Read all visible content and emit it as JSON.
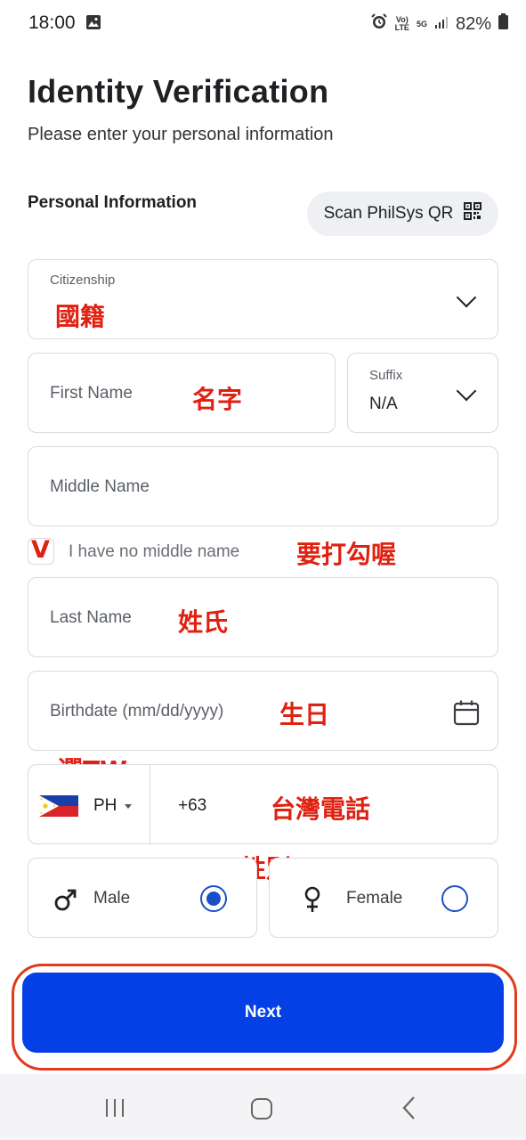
{
  "status_bar": {
    "time": "18:00",
    "battery": "82%",
    "network_top": "Vo)",
    "network_bottom": "LTE",
    "net_5g": "5G",
    "icons": [
      "image-icon",
      "alarm-icon",
      "signal-icon",
      "battery-icon"
    ]
  },
  "header": {
    "title": "Identity Verification",
    "subtitle": "Please enter your personal information"
  },
  "section": {
    "label": "Personal Information",
    "scan_button": "Scan PhilSys QR"
  },
  "form": {
    "citizenship": {
      "label": "Citizenship",
      "annotation": "國籍"
    },
    "first_name": {
      "placeholder": "First Name",
      "annotation": "名字"
    },
    "suffix": {
      "label": "Suffix",
      "value": "N/A"
    },
    "middle_name": {
      "placeholder": "Middle Name"
    },
    "no_middle_name": {
      "label": "I have no middle name",
      "check_mark": "V",
      "annotation": "要打勾喔"
    },
    "last_name": {
      "placeholder": "Last Name",
      "annotation": "姓氏"
    },
    "birthdate": {
      "placeholder": "Birthdate (mm/dd/yyyy)",
      "annotation": "生日"
    },
    "phone": {
      "country": "PH",
      "prefix": "+63",
      "annotation_country": "選TW",
      "annotation_number": "台灣電話"
    },
    "gender": {
      "annotation": "性別",
      "male": {
        "label": "Male",
        "selected": true
      },
      "female": {
        "label": "Female",
        "selected": false
      }
    }
  },
  "actions": {
    "next": "Next"
  },
  "colors": {
    "primary": "#0540e6",
    "radio": "#1a4fc9",
    "annotation": "#e02010"
  }
}
